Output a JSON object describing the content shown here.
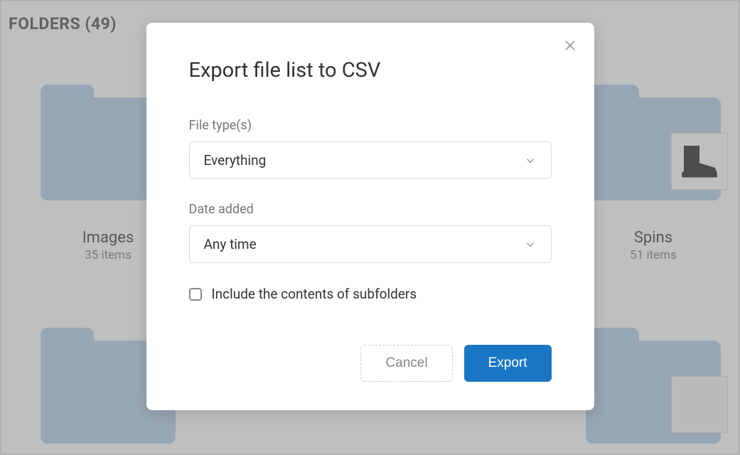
{
  "section": {
    "title": "FOLDERS (49)"
  },
  "folders": [
    {
      "name": "Images",
      "count": "35 items"
    },
    {
      "name": "Spins",
      "count": "51 items"
    }
  ],
  "modal": {
    "title": "Export file list to CSV",
    "file_type_label": "File type(s)",
    "file_type_value": "Everything",
    "date_label": "Date added",
    "date_value": "Any time",
    "checkbox_label": "Include the contents of subfolders",
    "cancel_label": "Cancel",
    "export_label": "Export"
  }
}
